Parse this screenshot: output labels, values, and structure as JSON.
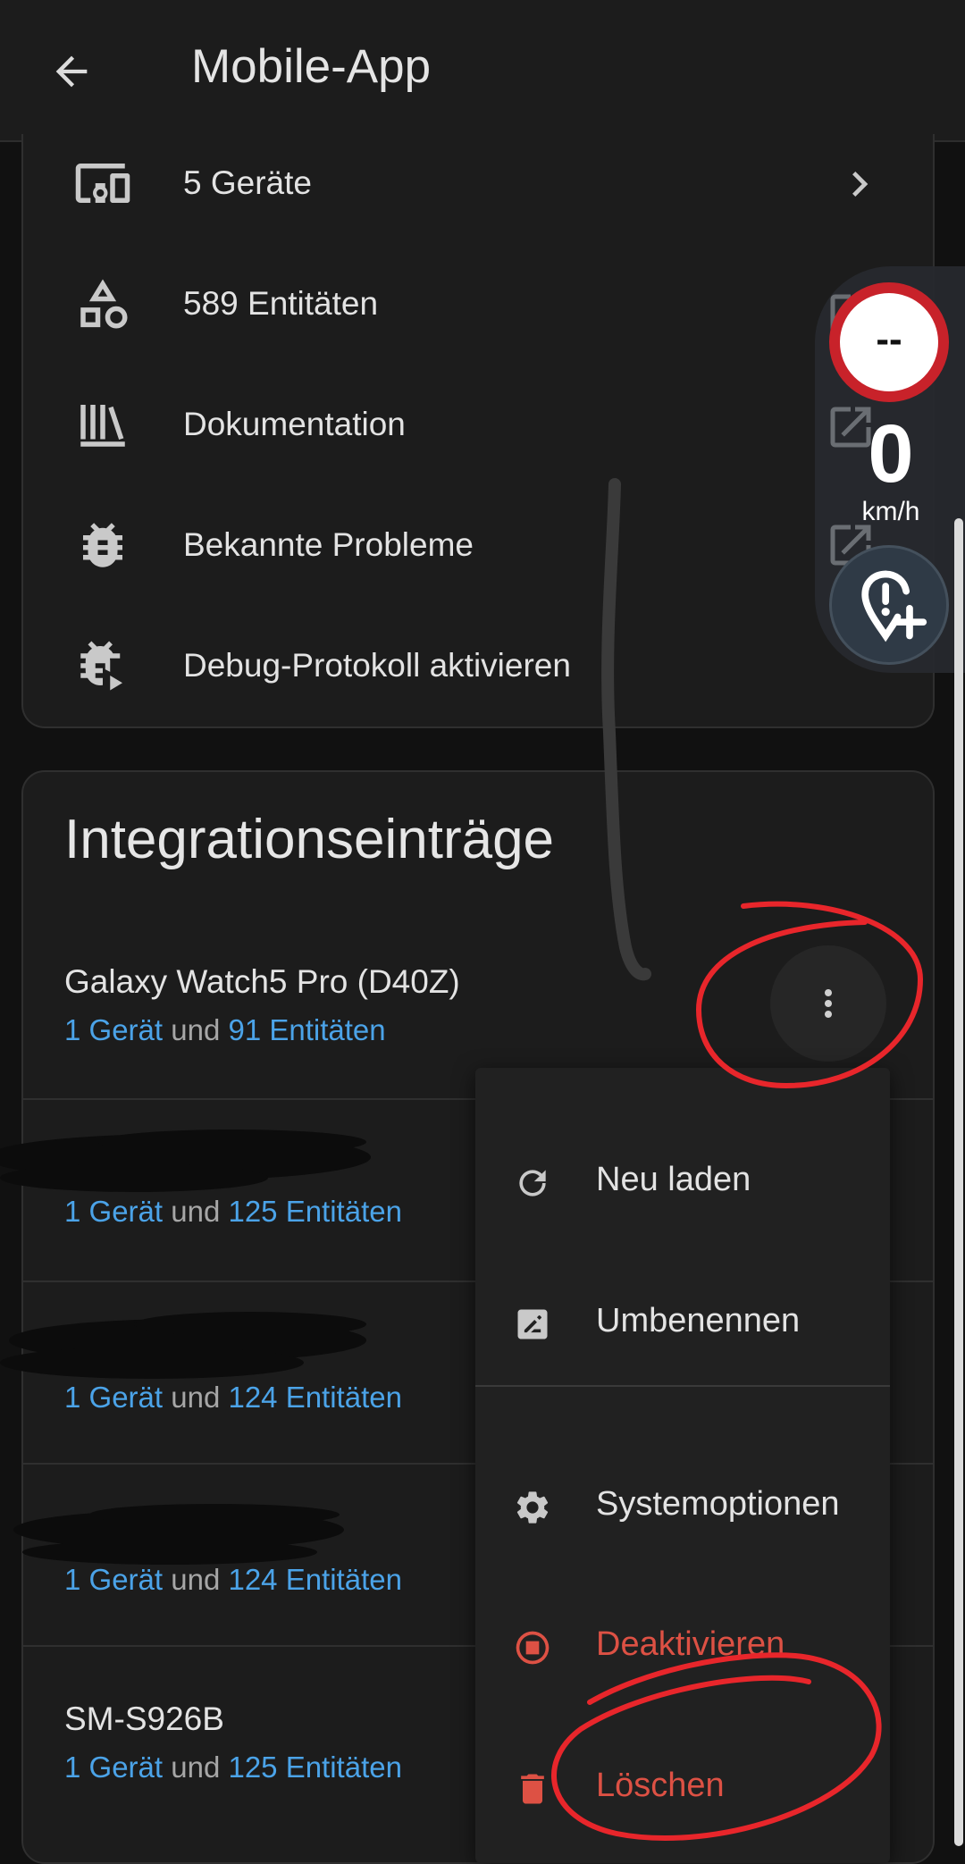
{
  "header": {
    "title": "Mobile-App"
  },
  "overview": {
    "items": [
      {
        "label": "5 Geräte",
        "icon": "devices-icon"
      },
      {
        "label": "589 Entitäten",
        "icon": "shapes-icon"
      },
      {
        "label": "Dokumentation",
        "icon": "library-icon"
      },
      {
        "label": "Bekannte Probleme",
        "icon": "bug-icon"
      },
      {
        "label": "Debug-Protokoll aktivieren",
        "icon": "bug-play-icon"
      }
    ]
  },
  "integrations": {
    "title": "Integrationseinträge",
    "conjunction": "und",
    "entries": [
      {
        "name": "Galaxy Watch5 Pro (D40Z)",
        "devices": "1 Gerät",
        "entities": "91 Entitäten"
      },
      {
        "name": "",
        "devices": "1 Gerät",
        "entities": "125 Entitäten"
      },
      {
        "name": "",
        "devices": "1 Gerät",
        "entities": "124 Entitäten"
      },
      {
        "name": "",
        "devices": "1 Gerät",
        "entities": "124 Entitäten"
      },
      {
        "name": "SM-S926B",
        "devices": "1 Gerät",
        "entities": "125 Entitäten"
      }
    ]
  },
  "menu": {
    "items": [
      {
        "label": "Neu laden",
        "icon": "reload-icon"
      },
      {
        "label": "Umbenennen",
        "icon": "rename-icon"
      },
      {
        "label": "Systemoptionen",
        "icon": "gear-icon"
      },
      {
        "label": "Deaktivieren",
        "icon": "stop-circle-icon"
      },
      {
        "label": "Löschen",
        "icon": "trash-icon"
      }
    ]
  },
  "speed_overlay": {
    "limit": "--",
    "speed": "0",
    "unit": "km/h"
  },
  "colors": {
    "accent_link": "#4ba3e8",
    "danger": "#dd5144",
    "annotation": "#e8262b"
  }
}
